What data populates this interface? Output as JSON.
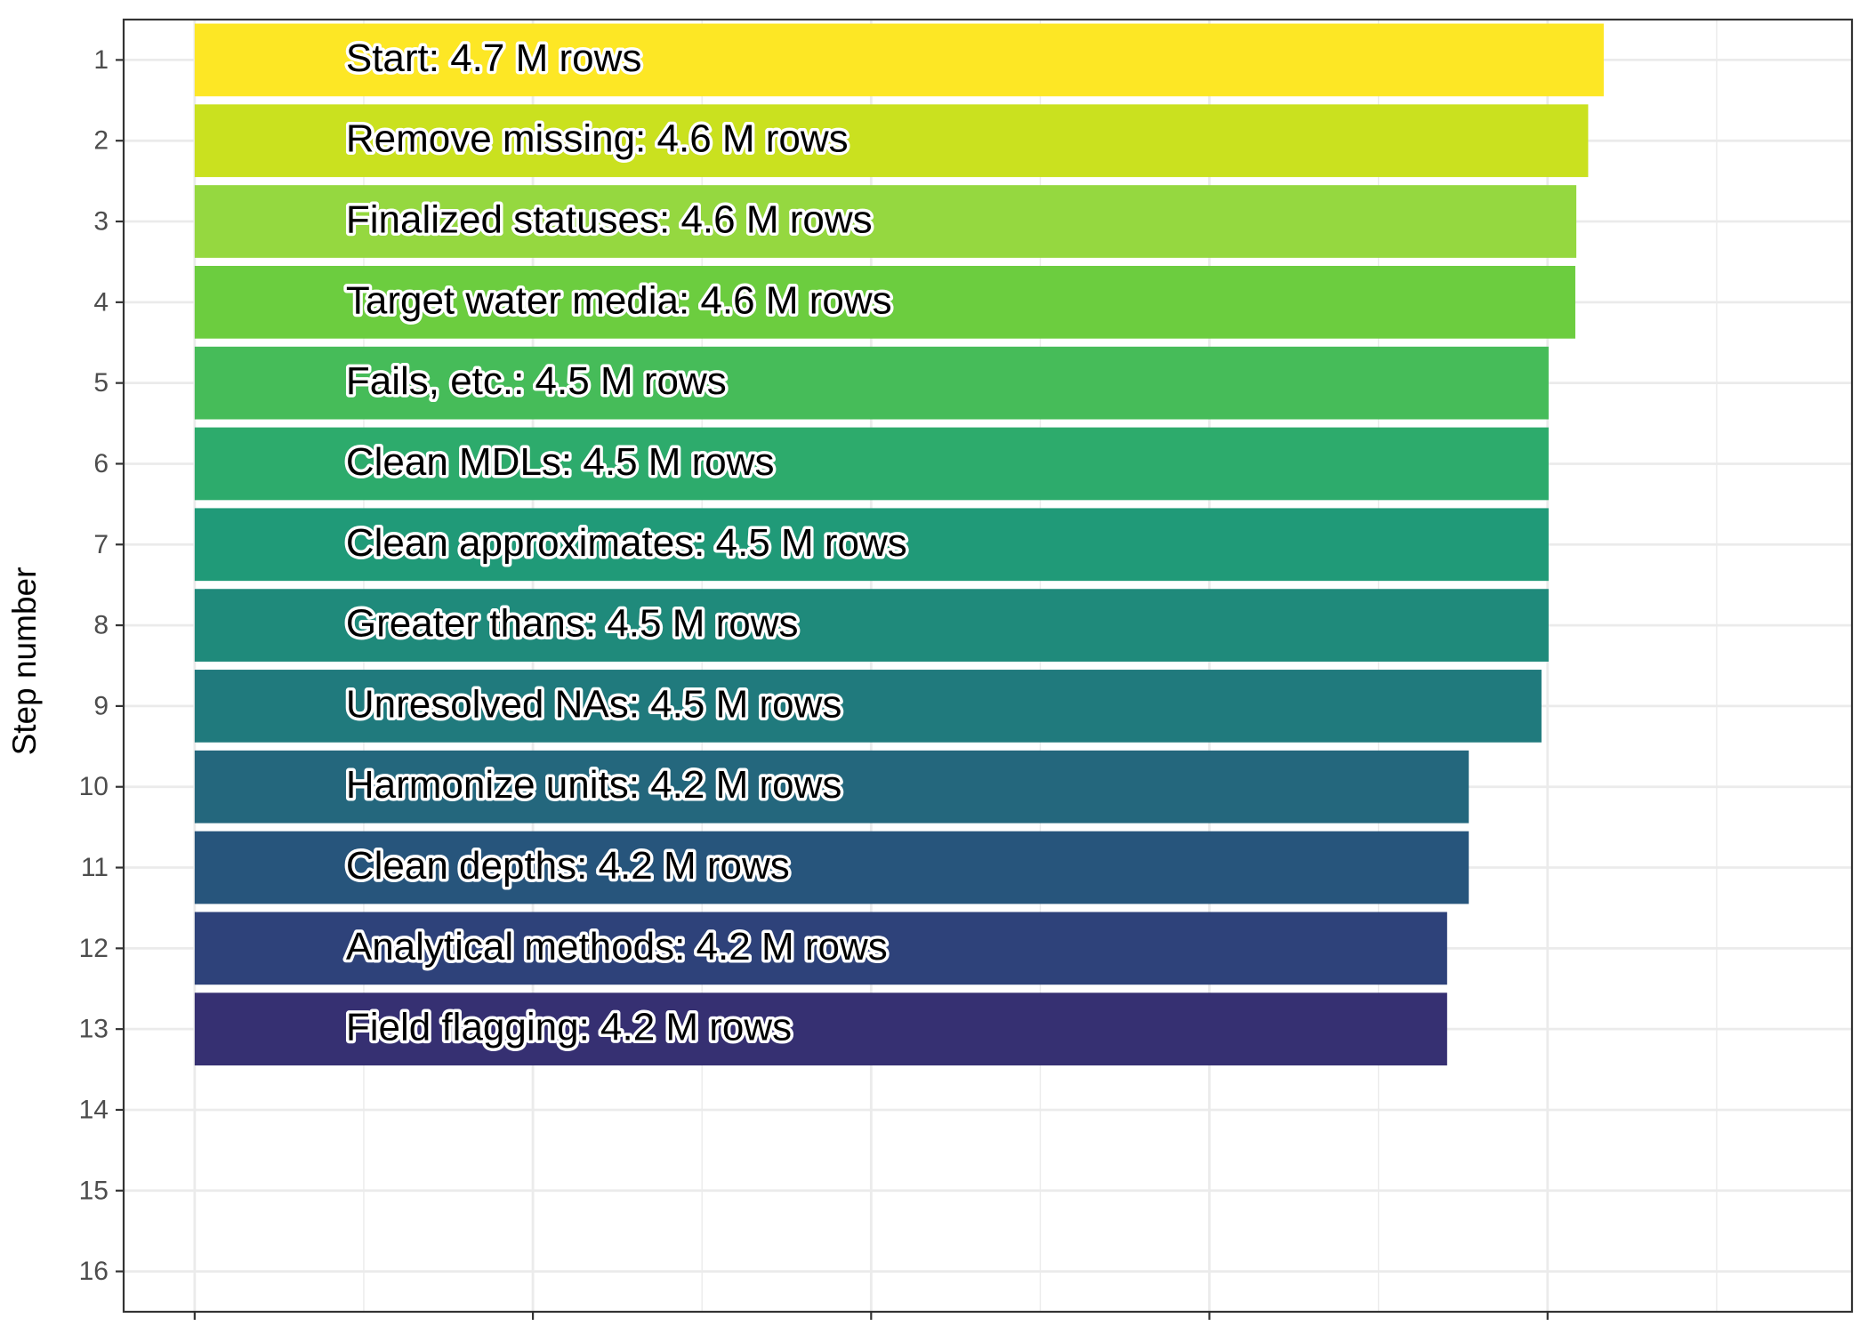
{
  "chart_data": {
    "type": "bar",
    "orientation": "horizontal",
    "ylabel": "Step number",
    "xlabel": "",
    "y_ticks": [
      1,
      2,
      3,
      4,
      5,
      6,
      7,
      8,
      9,
      10,
      11,
      12,
      13,
      14,
      15,
      16
    ],
    "ylim": [
      0.5,
      16.5
    ],
    "xlim": [
      -0.21,
      4.9
    ],
    "x_ticks": [
      0,
      1,
      2,
      3,
      4
    ],
    "x_tick_labels_visible": false,
    "grid": true,
    "bar_label_position": "inside-left",
    "steps": [
      {
        "step": 1,
        "label": "Start:  4.7 M rows",
        "value": 4.166,
        "color": "#FDE725"
      },
      {
        "step": 2,
        "label": "Remove missing:  4.6 M rows",
        "value": 4.12,
        "color": "#CAE11F"
      },
      {
        "step": 3,
        "label": "Finalized statuses:  4.6 M rows",
        "value": 4.085,
        "color": "#95D840"
      },
      {
        "step": 4,
        "label": "Target water media:  4.6 M rows",
        "value": 4.082,
        "color": "#6CCD3F"
      },
      {
        "step": 5,
        "label": "Fails, etc.:  4.5 M rows",
        "value": 4.003,
        "color": "#46BC59"
      },
      {
        "step": 6,
        "label": "Clean MDLs:  4.5 M rows",
        "value": 4.003,
        "color": "#2DAB6C"
      },
      {
        "step": 7,
        "label": "Clean approximates:  4.5 M rows",
        "value": 4.003,
        "color": "#209A78"
      },
      {
        "step": 8,
        "label": "Greater thans:  4.5 M rows",
        "value": 4.003,
        "color": "#1F8A7B"
      },
      {
        "step": 9,
        "label": "Unresolved NAs:  4.5 M rows",
        "value": 3.982,
        "color": "#207A7D"
      },
      {
        "step": 10,
        "label": "Harmonize units:  4.2 M rows",
        "value": 3.767,
        "color": "#24677D"
      },
      {
        "step": 11,
        "label": "Clean depths:  4.2 M rows",
        "value": 3.767,
        "color": "#27557C"
      },
      {
        "step": 12,
        "label": "Analytical methods:  4.2 M rows",
        "value": 3.703,
        "color": "#2E427A"
      },
      {
        "step": 13,
        "label": "Field flagging:  4.2 M rows",
        "value": 3.703,
        "color": "#363072"
      }
    ]
  }
}
